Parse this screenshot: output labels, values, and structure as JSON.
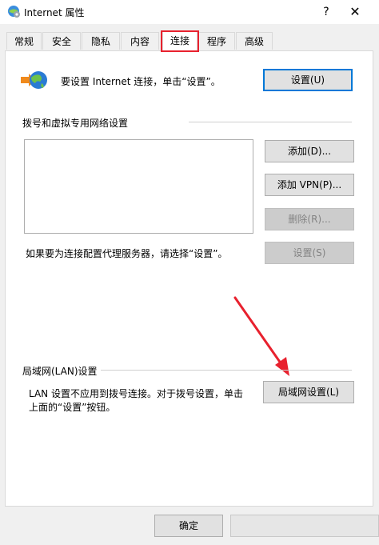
{
  "window": {
    "title": "Internet 属性",
    "help_label": "?",
    "close_label": "✕",
    "icon": "ie-settings-icon"
  },
  "tabs": [
    {
      "label": "常规"
    },
    {
      "label": "安全"
    },
    {
      "label": "隐私"
    },
    {
      "label": "内容"
    },
    {
      "label": "连接",
      "active": true
    },
    {
      "label": "程序"
    },
    {
      "label": "高级"
    }
  ],
  "setup": {
    "text": "要设置 Internet 连接，单击“设置”。",
    "button_label": "设置(U)",
    "icon": "globe-network-icon"
  },
  "dialup": {
    "group_title": "拨号和虚拟专用网络设置",
    "add_label": "添加(D)...",
    "add_vpn_label": "添加 VPN(P)...",
    "delete_label": "删除(R)...",
    "proxy_text": "如果要为连接配置代理服务器，请选择“设置”。",
    "settings_label": "设置(S)"
  },
  "lan": {
    "group_title": "局域网(LAN)设置",
    "text_line1": "LAN 设置不应用到拨号连接。对于拨号设置，单击",
    "text_line2": "上面的“设置”按钮。",
    "button_label": "局域网设置(L)"
  },
  "footer": {
    "ok_label": "确定"
  },
  "colors": {
    "highlight_red": "#e8212e",
    "accent_blue": "#0078d7",
    "dialog_bg": "#f0f0f0"
  }
}
